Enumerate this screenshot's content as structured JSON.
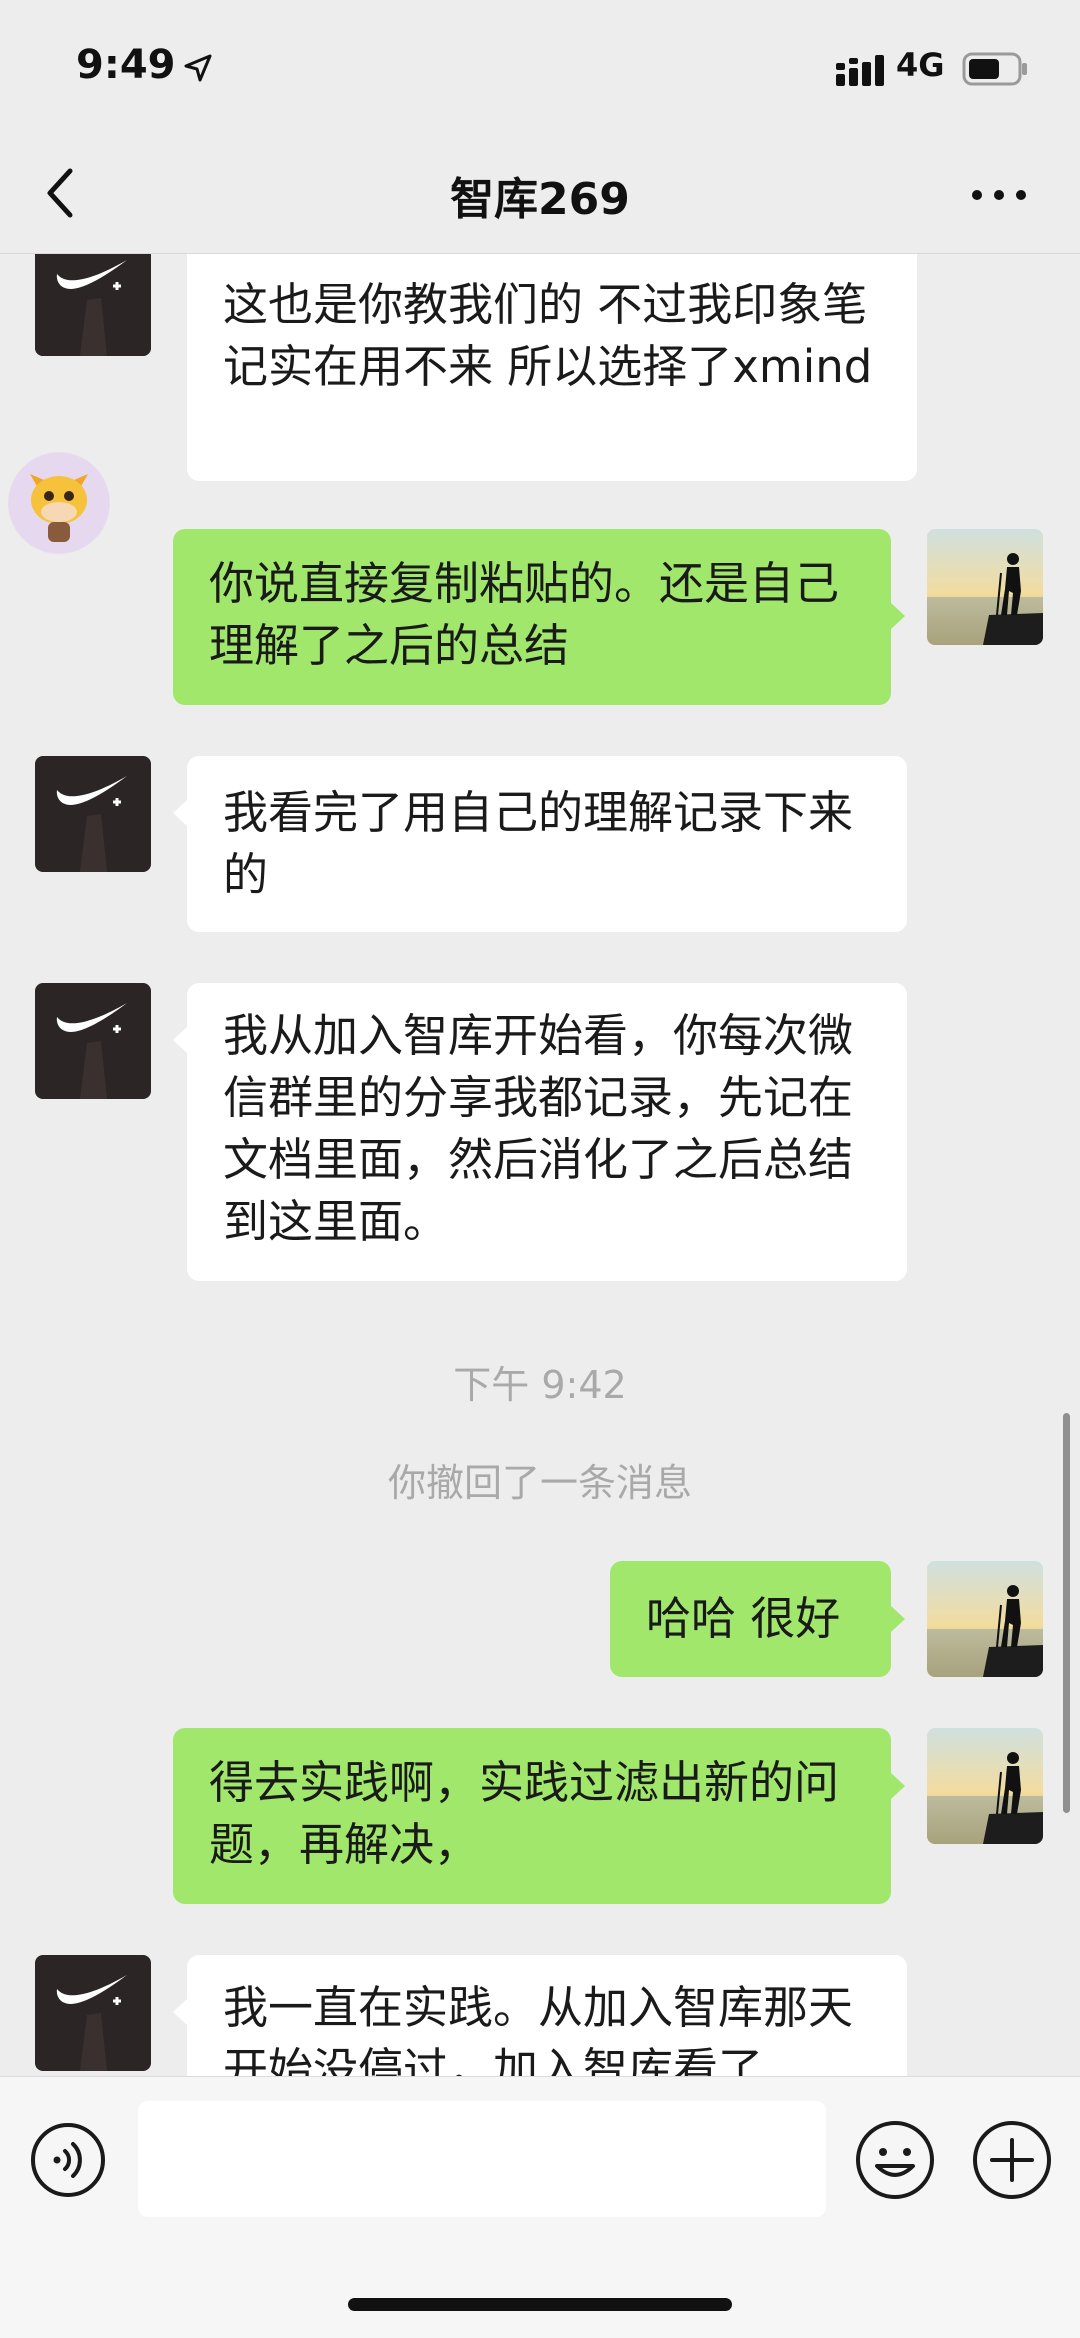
{
  "status_bar": {
    "time": "9:49",
    "network": "4G"
  },
  "header": {
    "title": "智库269"
  },
  "messages": [
    {
      "id": "m1",
      "side": "in",
      "text": "这也是你教我们的 不过我印象笔记实在用不来 所以选择了xmind"
    },
    {
      "id": "m2",
      "side": "out",
      "text": "你说直接复制粘贴的。还是自己理解了之后的总结"
    },
    {
      "id": "m3",
      "side": "in",
      "text": "我看完了用自己的理解记录下来的"
    },
    {
      "id": "m4",
      "side": "in",
      "text": "我从加入智库开始看，你每次微信群里的分享我都记录，先记在文档里面，然后消化了之后总结到这里面。"
    },
    {
      "id": "ts",
      "type": "timestamp",
      "text": "下午 9:42"
    },
    {
      "id": "recall",
      "type": "system",
      "text": "你撤回了一条消息"
    },
    {
      "id": "m5",
      "side": "out",
      "text": "哈哈 很好"
    },
    {
      "id": "m6",
      "side": "out",
      "text": "得去实践啊，实践过滤出新的问题，再解决，"
    },
    {
      "id": "m7",
      "side": "in",
      "text": "我一直在实践。从加入智库那天开始没停过，加入智库看了"
    }
  ],
  "input_bar": {
    "voice_icon": "voice-icon",
    "emoji_icon": "emoji-icon",
    "plus_icon": "plus-icon",
    "draft": ""
  }
}
